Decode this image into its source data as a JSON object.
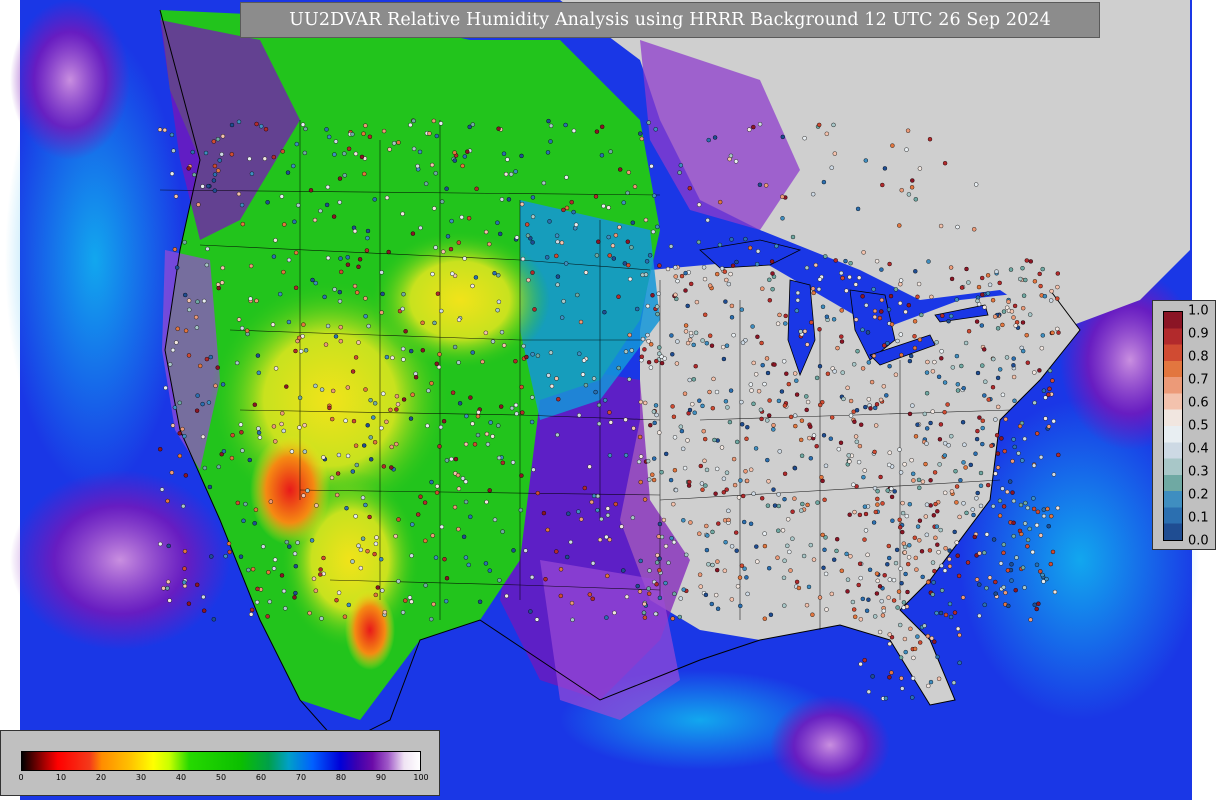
{
  "title": "UU2DVAR Relative Humidity Analysis using HRRR Background 12 UTC 26 Sep 2024",
  "colors": {
    "ocean_blue": "#1a37e6",
    "ocean_cyan": "#12a7ee",
    "purple": "#7a16b8",
    "magenta": "#c98fe0",
    "land_gray": "#cfcfcf",
    "green": "#22c41c",
    "yellow": "#f1e31a",
    "orange": "#f58a12",
    "red": "#e81a1a",
    "border_line": "#000000"
  },
  "analysis_colorbar": {
    "ticks": [
      "0",
      "10",
      "20",
      "30",
      "40",
      "50",
      "60",
      "70",
      "80",
      "90",
      "100"
    ],
    "min": 0,
    "max": 100,
    "stops": [
      {
        "v": 0,
        "c": "#000000"
      },
      {
        "v": 3,
        "c": "#5a0000"
      },
      {
        "v": 6,
        "c": "#b00000"
      },
      {
        "v": 9,
        "c": "#ff0000"
      },
      {
        "v": 17,
        "c": "#f43a1a"
      },
      {
        "v": 20,
        "c": "#ff8c00"
      },
      {
        "v": 27,
        "c": "#ffc000"
      },
      {
        "v": 33,
        "c": "#ffff00"
      },
      {
        "v": 37,
        "c": "#c8ff00"
      },
      {
        "v": 42,
        "c": "#26d900"
      },
      {
        "v": 55,
        "c": "#0bbf00"
      },
      {
        "v": 62,
        "c": "#00a04a"
      },
      {
        "v": 67,
        "c": "#00a0c8"
      },
      {
        "v": 73,
        "c": "#0060ff"
      },
      {
        "v": 80,
        "c": "#0000d8"
      },
      {
        "v": 84,
        "c": "#3a00b0"
      },
      {
        "v": 88,
        "c": "#6a0aa8"
      },
      {
        "v": 92,
        "c": "#a05ac8"
      },
      {
        "v": 96,
        "c": "#f0e4f4"
      },
      {
        "v": 100,
        "c": "#ffffff"
      }
    ]
  },
  "observation_colorbar": {
    "ticks": [
      "1.0",
      "0.9",
      "0.8",
      "0.7",
      "0.6",
      "0.5",
      "0.4",
      "0.3",
      "0.2",
      "0.1",
      "0.0"
    ],
    "colors": [
      "#8b1525",
      "#b22a2c",
      "#d04b32",
      "#e2763f",
      "#ec9a78",
      "#f3c2ad",
      "#f1e6e0",
      "#e8eef2",
      "#cdd9e4",
      "#a8c7c8",
      "#6fa9a3",
      "#3f8ec0",
      "#2b6fb0",
      "#1f4d92"
    ]
  }
}
